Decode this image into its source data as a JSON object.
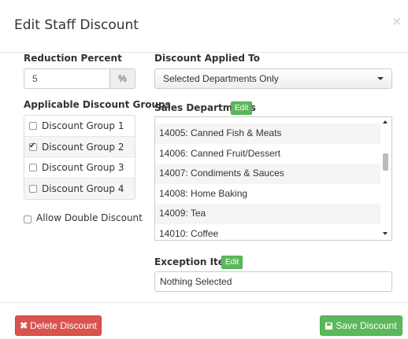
{
  "modal": {
    "title": "Edit Staff Discount",
    "close_glyph": "×"
  },
  "reduction": {
    "label": "Reduction Percent",
    "value": "5",
    "addon": "%"
  },
  "applied_to": {
    "label": "Discount Applied To",
    "selected": "Selected Departments Only"
  },
  "groups": {
    "label": "Applicable Discount Groups",
    "items": [
      {
        "label": "Discount Group 1",
        "checked": false
      },
      {
        "label": "Discount Group 2",
        "checked": true
      },
      {
        "label": "Discount Group 3",
        "checked": false
      },
      {
        "label": "Discount Group 4",
        "checked": false
      }
    ]
  },
  "allow_double": {
    "label": "Allow Double Discount",
    "checked": false
  },
  "departments": {
    "label": "Sales Departments",
    "edit_label": "Edit",
    "items": [
      "14005: Canned Fish & Meats",
      "14006: Canned Fruit/Dessert",
      "14007: Condiments & Sauces",
      "14008: Home Baking",
      "14009: Tea",
      "14010: Coffee"
    ]
  },
  "exceptions": {
    "label": "Exception Items",
    "edit_label": "Edit",
    "value": "Nothing Selected"
  },
  "footer": {
    "delete_icon": "✖",
    "delete_label": "Delete Discount",
    "save_label": "Save Discount"
  },
  "colors": {
    "success": "#5cb85c",
    "danger": "#d9534f",
    "border": "#cccccc"
  }
}
